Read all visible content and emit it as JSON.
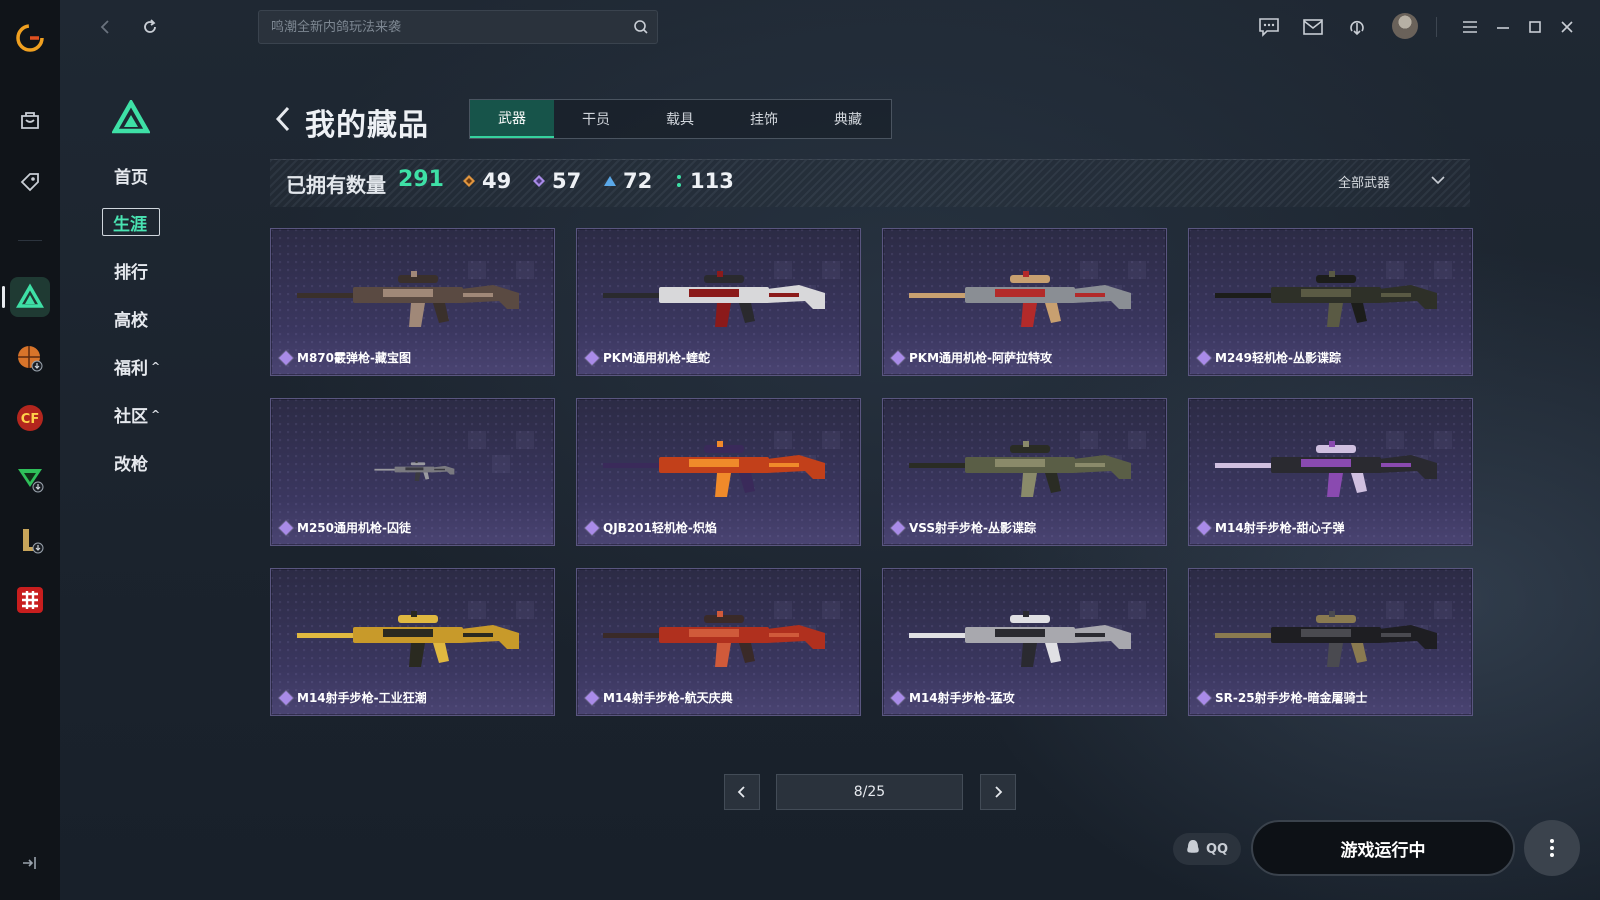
{
  "topbar": {
    "search_placeholder": "鸣潮全新内鸽玩法来袭"
  },
  "sidebar": {
    "items": [
      {
        "label": "首页"
      },
      {
        "label": "生涯"
      },
      {
        "label": "排行"
      },
      {
        "label": "高校"
      },
      {
        "label": "福利"
      },
      {
        "label": "社区"
      },
      {
        "label": "改枪"
      }
    ]
  },
  "header": {
    "title": "我的藏品",
    "tabs": [
      {
        "label": "武器"
      },
      {
        "label": "干员"
      },
      {
        "label": "载具"
      },
      {
        "label": "挂饰"
      },
      {
        "label": "典藏"
      }
    ]
  },
  "summary": {
    "label": "已拥有数量",
    "total": "291",
    "stats": [
      {
        "value": "49",
        "color": "#e0953e"
      },
      {
        "value": "57",
        "color": "#a98be8"
      },
      {
        "value": "72",
        "color": "#5aa8e8"
      },
      {
        "value": "113",
        "color": "#3ee0a6"
      }
    ],
    "filter_label": "全部武器"
  },
  "items": [
    {
      "name": "M870霰弹枪-藏宝图",
      "colors": [
        "#5a4a42",
        "#a08878",
        "#3a302b"
      ]
    },
    {
      "name": "PKM通用机枪-蝰蛇",
      "colors": [
        "#d8d8da",
        "#8b1a1a",
        "#2a2a2e"
      ]
    },
    {
      "name": "PKM通用机枪-阿萨拉特攻",
      "colors": [
        "#8a8e94",
        "#b32a2a",
        "#c8a070"
      ]
    },
    {
      "name": "M249轻机枪-丛影谍踪",
      "colors": [
        "#2e3028",
        "#5a5a44",
        "#1c1d1a"
      ]
    },
    {
      "name": "M250通用机枪-囚徒",
      "colors": [
        "#7a7a80",
        "#3a3a40",
        "#9a9aa0"
      ]
    },
    {
      "name": "QJB201轻机枪-炽焰",
      "colors": [
        "#c2401a",
        "#f08a2a",
        "#3a2a5a"
      ]
    },
    {
      "name": "VSS射手步枪-丛影谍踪",
      "colors": [
        "#5a5e46",
        "#8a8a6a",
        "#2a2c24"
      ]
    },
    {
      "name": "M14射手步枪-甜心子弹",
      "colors": [
        "#2a2a30",
        "#8a4ab0",
        "#d0c0e0"
      ]
    },
    {
      "name": "M14射手步枪-工业狂潮",
      "colors": [
        "#c89a2a",
        "#2a2a20",
        "#e0b840"
      ]
    },
    {
      "name": "M14射手步枪-航天庆典",
      "colors": [
        "#b0301e",
        "#d05a3a",
        "#3a2a28"
      ]
    },
    {
      "name": "M14射手步枪-猛攻",
      "colors": [
        "#a8a8ae",
        "#2a2a30",
        "#e0e0e4"
      ]
    },
    {
      "name": "SR-25射手步枪-暗金屠骑士",
      "colors": [
        "#1e1e22",
        "#4a4a50",
        "#8a7a50"
      ]
    }
  ],
  "pagination": {
    "indicator": "8/25"
  },
  "bottom": {
    "qq_label": "QQ",
    "run_label": "游戏运行中"
  }
}
